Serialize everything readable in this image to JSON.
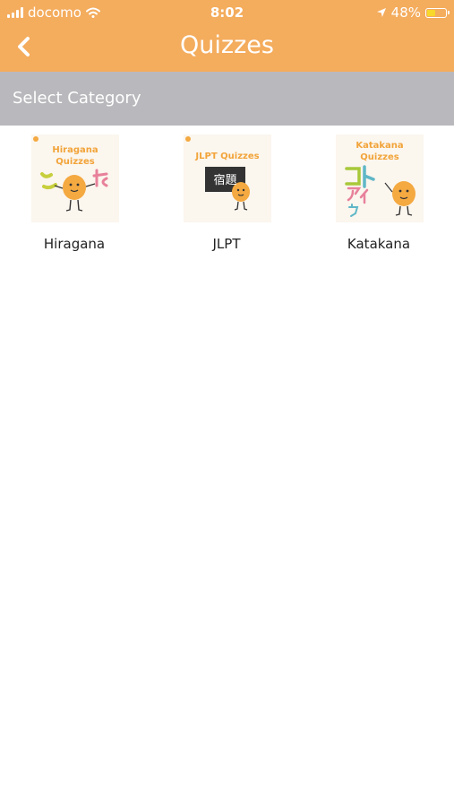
{
  "status_bar": {
    "carrier": "docomo",
    "time": "8:02",
    "battery_percent": "48%",
    "battery_level": 0.48
  },
  "nav": {
    "title": "Quizzes",
    "back_icon": "chevron-left-icon"
  },
  "section": {
    "title": "Select Category"
  },
  "categories": [
    {
      "label": "Hiragana",
      "thumb_title_line1": "Hiragana",
      "thumb_title_line2": "Quizzes"
    },
    {
      "label": "JLPT",
      "thumb_title_line1": "JLPT Quizzes",
      "board_text": "宿題"
    },
    {
      "label": "Katakana",
      "thumb_title_line1": "Katakana",
      "thumb_title_line2": "Quizzes"
    }
  ],
  "colors": {
    "header": "#f4ac5d",
    "section": "#b9b9bd",
    "mascot": "#f4a941",
    "thumb_bg": "#fbf6ee"
  }
}
